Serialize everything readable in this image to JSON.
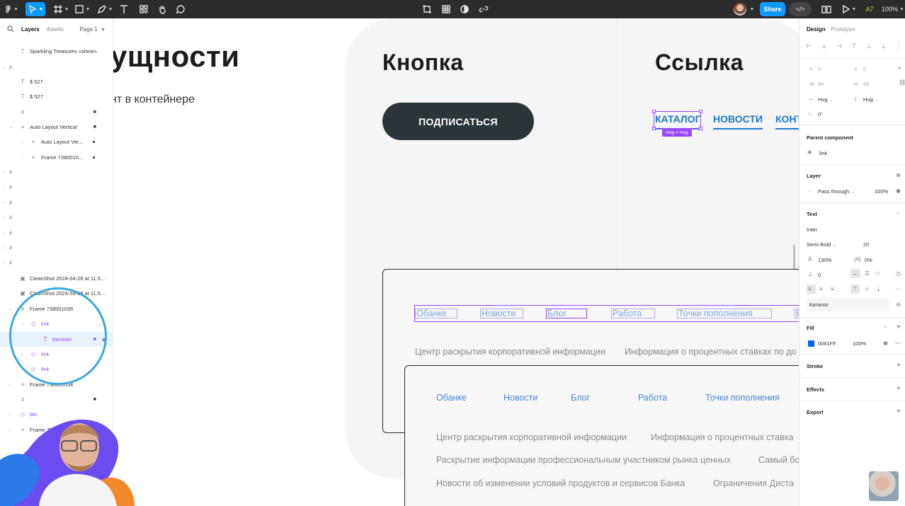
{
  "toolbar": {
    "share_label": "Share",
    "devmode_label": "</>",
    "a7_label": "A7",
    "zoom_label": "100%"
  },
  "layers_panel": {
    "tab_layers": "Layers",
    "tab_assets": "Assets",
    "page_label": "Page 1",
    "items": [
      {
        "name": "Sparkling Treasures «shine»"
      },
      {
        "name": "$ 527"
      },
      {
        "name": "$ 527"
      },
      {
        "name": "Auto Layout Vertical"
      },
      {
        "name": "Auto Layout Ver..."
      },
      {
        "name": "Frame 7380010..."
      },
      {
        "name": "CleanShot 2024-04-28 at 11.5..."
      },
      {
        "name": "CleanShot 2024-04-28 at 11.5..."
      },
      {
        "name": "Frame 738001035"
      },
      {
        "name": "link"
      },
      {
        "name": "Каталог"
      },
      {
        "name": "link"
      },
      {
        "name": "link"
      },
      {
        "name": "Frame 738001034"
      },
      {
        "name": "btn"
      },
      {
        "name": "Frame 73..."
      }
    ]
  },
  "canvas": {
    "heading_1": "ущности",
    "subtext": "нт в контейнере",
    "heading_button": "Кнопка",
    "button_label": "ПОДПИСАТЬСЯ",
    "heading_link": "Ссылка",
    "link_catalog": "КАТАЛОГ",
    "link_news": "НОВОСТИ",
    "link_cont": "КОНТ",
    "hug_badge": "Hug × Hug",
    "nav_row": [
      "Обанке",
      "Новости",
      "Блог",
      "Работа",
      "Точки пополнения",
      "Е"
    ],
    "gray_line_1a": "Центр раскрытия корпоративной информации",
    "gray_line_1b": "Информация о процентных ставках по до",
    "nav2": [
      "Обанке",
      "Новости",
      "Блог",
      "Работа",
      "Точки пополнения"
    ],
    "line2a": "Центр раскрытия корпоративной информации",
    "line2b": "Информация о процентных ставка",
    "line3a": "Раскрытие информации профессиональным участником рынка ценных",
    "line3b": "Самый бо",
    "line4a": "Новости об изменении условий продуктов и сервисов Банка",
    "line4b": "Ограничения Дистa"
  },
  "design_panel": {
    "tab_design": "Design",
    "tab_prototype": "Prototype",
    "x_label": "X",
    "x_val": "0",
    "y_label": "Y",
    "y_val": "0",
    "w_label": "W",
    "w_val": "94",
    "h_label": "H",
    "h_val": "28",
    "w_hug": "Hug",
    "h_hug": "Hug",
    "rotation": "0°",
    "parent_component_title": "Parent component",
    "parent_component_name": "link",
    "layer_title": "Layer",
    "blend": "Pass through",
    "layer_opacity": "100%",
    "text_title": "Text",
    "font_family": "Inter",
    "font_weight": "Semi Bold",
    "font_size": "20",
    "line_height": "130%",
    "letter_spacing": "0%",
    "para_spacing": "0",
    "text_style_value": "Каталог",
    "fill_title": "Fill",
    "fill_hex": "0061FF",
    "fill_opacity": "100%",
    "fill_color": "#0061ff",
    "stroke_title": "Stroke",
    "effects_title": "Effects",
    "export_title": "Export"
  }
}
